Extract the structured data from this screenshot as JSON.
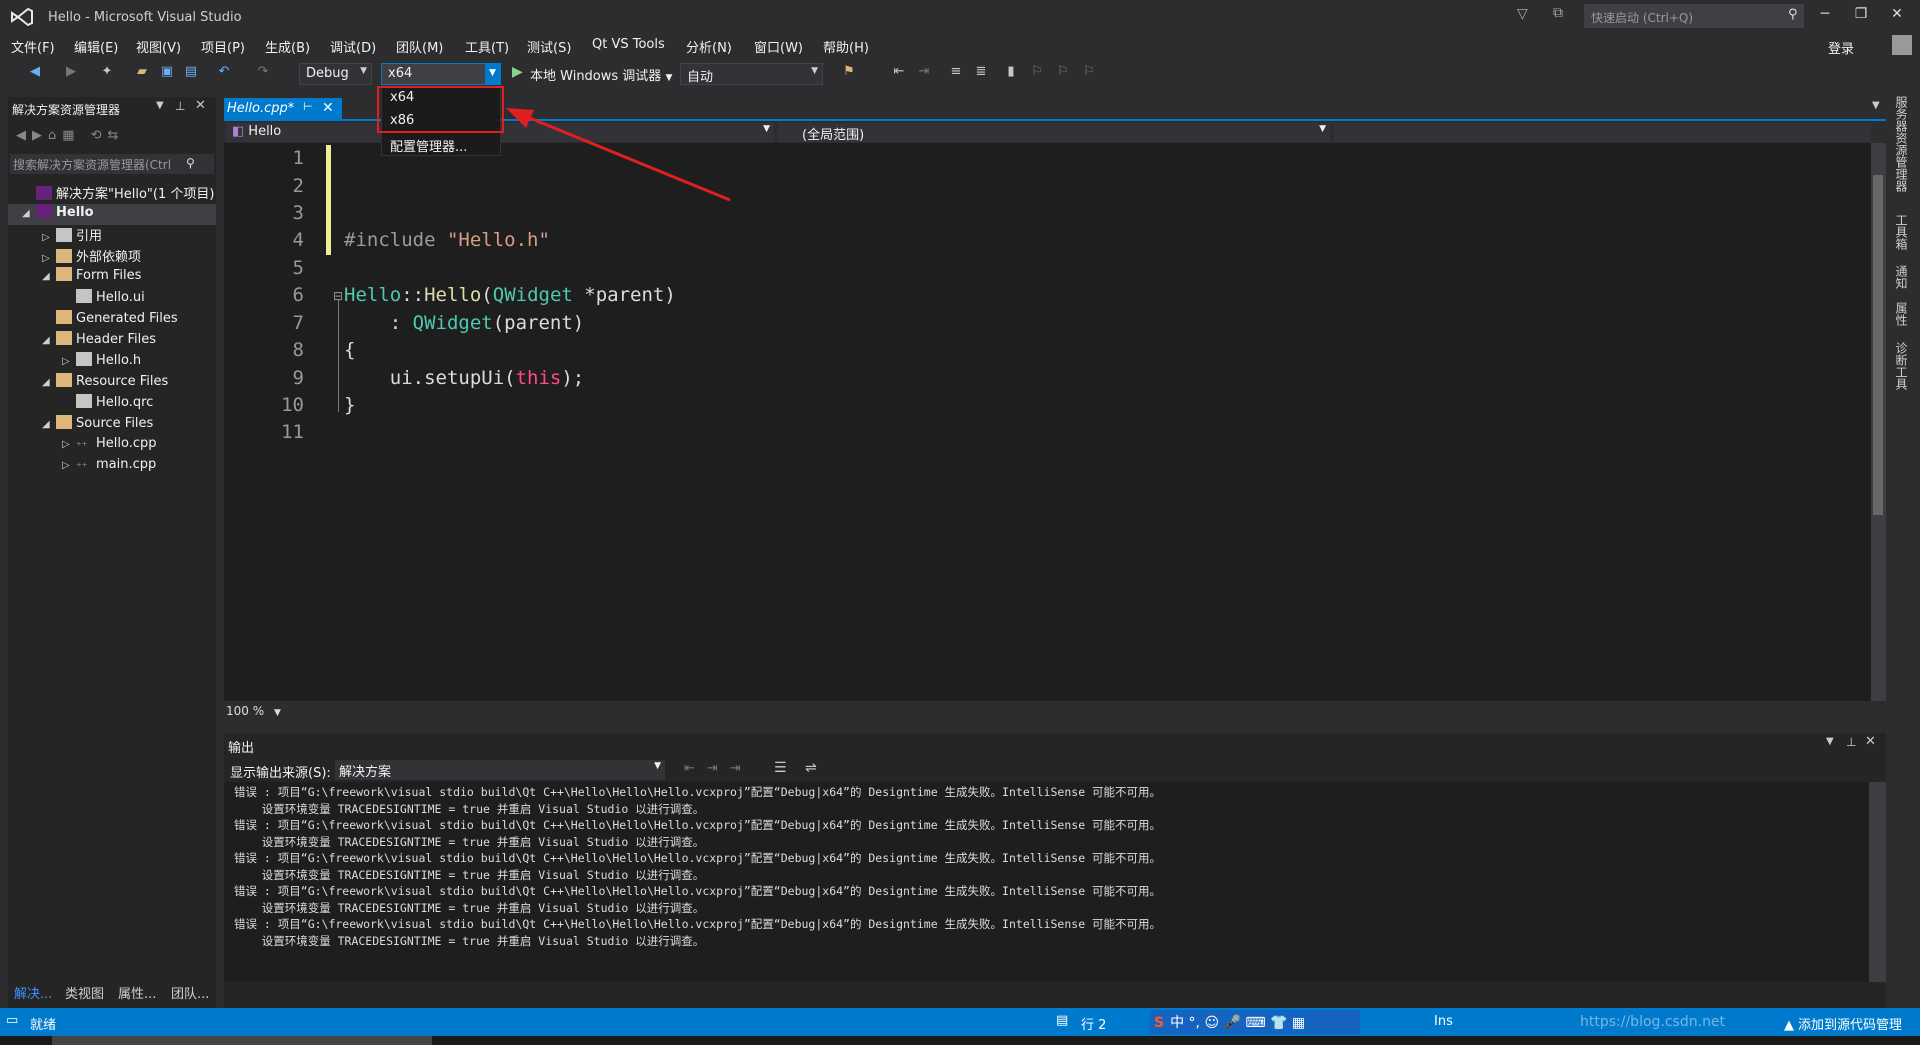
{
  "window": {
    "title": "Hello - Microsoft Visual Studio",
    "quick_launch": "快速启动 (Ctrl+Q)",
    "login": "登录"
  },
  "menu": [
    "文件(F)",
    "编辑(E)",
    "视图(V)",
    "项目(P)",
    "生成(B)",
    "调试(D)",
    "团队(M)",
    "工具(T)",
    "测试(S)",
    "Qt VS Tools",
    "分析(N)",
    "窗口(W)",
    "帮助(H)"
  ],
  "toolbar": {
    "config": "Debug",
    "platform": "x64",
    "run_label": "本地 Windows 调试器",
    "run_mode": "自动"
  },
  "platform_dropdown": {
    "options": [
      "x64",
      "x86"
    ],
    "manager": "配置管理器..."
  },
  "solution_explorer": {
    "title": "解决方案资源管理器",
    "search_placeholder": "搜索解决方案资源管理器(Ctrl",
    "tree": [
      {
        "label": "解决方案\"Hello\"(1 个项目)",
        "level": 0,
        "icon": "solution-icon",
        "twist": ""
      },
      {
        "label": "Hello",
        "level": 0,
        "icon": "project-icon",
        "twist": "◢",
        "selected": true
      },
      {
        "label": "引用",
        "level": 1,
        "icon": "references-icon",
        "twist": "▷"
      },
      {
        "label": "外部依赖项",
        "level": 1,
        "icon": "folder-icon",
        "twist": "▷"
      },
      {
        "label": "Form Files",
        "level": 1,
        "icon": "folder-icon",
        "twist": "◢"
      },
      {
        "label": "Hello.ui",
        "level": 2,
        "icon": "file-icon",
        "twist": ""
      },
      {
        "label": "Generated Files",
        "level": 1,
        "icon": "folder-icon",
        "twist": ""
      },
      {
        "label": "Header Files",
        "level": 1,
        "icon": "folder-icon",
        "twist": "◢"
      },
      {
        "label": "Hello.h",
        "level": 2,
        "icon": "file-icon",
        "twist": "▷"
      },
      {
        "label": "Resource Files",
        "level": 1,
        "icon": "folder-icon",
        "twist": "◢"
      },
      {
        "label": "Hello.qrc",
        "level": 2,
        "icon": "file-icon",
        "twist": ""
      },
      {
        "label": "Source Files",
        "level": 1,
        "icon": "folder-icon",
        "twist": "◢"
      },
      {
        "label": "Hello.cpp",
        "level": 2,
        "icon": "cpp-icon",
        "twist": "▷"
      },
      {
        "label": "main.cpp",
        "level": 2,
        "icon": "cpp-icon",
        "twist": "▷"
      }
    ],
    "bottom_tabs": [
      "解决...",
      "类视图",
      "属性...",
      "团队..."
    ]
  },
  "editor": {
    "tab": "Hello.cpp*",
    "nav_scope": "Hello",
    "nav_member": "(全局范围)",
    "lines": [
      "1",
      "2",
      "3",
      "4",
      "5",
      "6",
      "7",
      "8",
      "9",
      "10",
      "11"
    ],
    "code": {
      "l4_pre": "#include ",
      "l4_str": "\"Hello.h\"",
      "l6_a": "Hello",
      "l6_b": "::",
      "l6_c": "Hello",
      "l6_d": "(",
      "l6_e": "QWidget",
      "l6_f": " *parent)",
      "l7_a": "    : ",
      "l7_b": "QWidget",
      "l7_c": "(parent)",
      "l8": "{",
      "l9_a": "    ui.setupUi(",
      "l9_b": "this",
      "l9_c": ");",
      "l10": "}"
    },
    "zoom": "100 %"
  },
  "output": {
    "title": "输出",
    "source_label": "显示输出来源(S):",
    "source_value": "解决方案",
    "text": "错误 : 项目“G:\\freework\\visual stdio build\\Qt C++\\Hello\\Hello\\Hello.vcxproj”配置“Debug|x64”的 Designtime 生成失败。IntelliSense 可能不可用。\n    设置环境变量 TRACEDESIGNTIME = true 并重启 Visual Studio 以进行调查。\n错误 : 项目“G:\\freework\\visual stdio build\\Qt C++\\Hello\\Hello\\Hello.vcxproj”配置“Debug|x64”的 Designtime 生成失败。IntelliSense 可能不可用。\n    设置环境变量 TRACEDESIGNTIME = true 并重启 Visual Studio 以进行调查。\n错误 : 项目“G:\\freework\\visual stdio build\\Qt C++\\Hello\\Hello\\Hello.vcxproj”配置“Debug|x64”的 Designtime 生成失败。IntelliSense 可能不可用。\n    设置环境变量 TRACEDESIGNTIME = true 并重启 Visual Studio 以进行调查。\n错误 : 项目“G:\\freework\\visual stdio build\\Qt C++\\Hello\\Hello\\Hello.vcxproj”配置“Debug|x64”的 Designtime 生成失败。IntelliSense 可能不可用。\n    设置环境变量 TRACEDESIGNTIME = true 并重启 Visual Studio 以进行调查。\n错误 : 项目“G:\\freework\\visual stdio build\\Qt C++\\Hello\\Hello\\Hello.vcxproj”配置“Debug|x64”的 Designtime 生成失败。IntelliSense 可能不可用。\n    设置环境变量 TRACEDESIGNTIME = true 并重启 Visual Studio 以进行调查。"
  },
  "right_tabs": [
    "服务器资源管理器",
    "工具箱",
    "通知",
    "属性",
    "诊断工具"
  ],
  "status": {
    "ready": "就绪",
    "line": "行 2",
    "ins": "Ins",
    "source_control": "添加到源代码管理",
    "ime": "中 °, ☺ 🎤 ⌨ 👕 ▦",
    "watermark": "https://blog.csdn.net"
  },
  "colors": {
    "accent": "#007acc",
    "annotation": "#e02020"
  }
}
